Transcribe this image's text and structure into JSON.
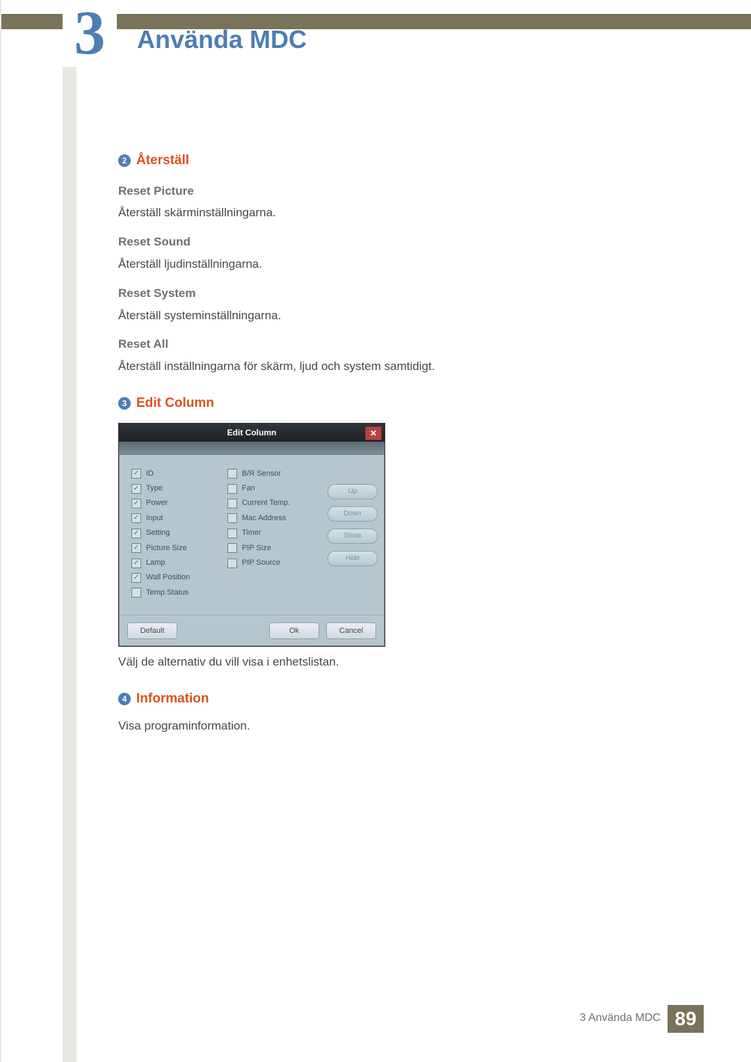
{
  "header": {
    "chapter_number": "3",
    "chapter_title": "Använda MDC"
  },
  "section_reset": {
    "bullet": "2",
    "title": "Återställ",
    "items": [
      {
        "label": "Reset Picture",
        "desc": "Återställ skärminställningarna."
      },
      {
        "label": "Reset Sound",
        "desc": "Återställ ljudinställningarna."
      },
      {
        "label": "Reset System",
        "desc": "Återställ systeminställningarna."
      },
      {
        "label": "Reset All",
        "desc": "Återställ inställningarna för skärm, ljud och system samtidigt."
      }
    ]
  },
  "section_edit": {
    "bullet": "3",
    "title": "Edit Column",
    "caption": "Välj de alternativ du vill visa i enhetslistan."
  },
  "dialog": {
    "title": "Edit Column",
    "close_glyph": "✕",
    "col1": [
      {
        "label": "ID",
        "checked": true
      },
      {
        "label": "Type",
        "checked": true
      },
      {
        "label": "Power",
        "checked": true
      },
      {
        "label": "Input",
        "checked": true
      },
      {
        "label": "Setting",
        "checked": true
      },
      {
        "label": "Picture Size",
        "checked": true
      },
      {
        "label": "Lamp",
        "checked": true
      },
      {
        "label": "Wall Position",
        "checked": true
      },
      {
        "label": "Temp.Status",
        "checked": false
      }
    ],
    "col2": [
      {
        "label": "B/R Sensor",
        "checked": false
      },
      {
        "label": "Fan",
        "checked": false
      },
      {
        "label": "Current Temp.",
        "checked": false
      },
      {
        "label": "Mac Address",
        "checked": false
      },
      {
        "label": "Timer",
        "checked": false
      },
      {
        "label": "PIP Size",
        "checked": false
      },
      {
        "label": "PIP Source",
        "checked": false
      }
    ],
    "side_buttons": [
      "Up",
      "Down",
      "Show",
      "Hide"
    ],
    "footer": {
      "default": "Default",
      "ok": "Ok",
      "cancel": "Cancel"
    }
  },
  "section_info": {
    "bullet": "4",
    "title": "Information",
    "desc": "Visa programinformation."
  },
  "page_footer": {
    "label": "3 Använda MDC",
    "page_number": "89"
  }
}
